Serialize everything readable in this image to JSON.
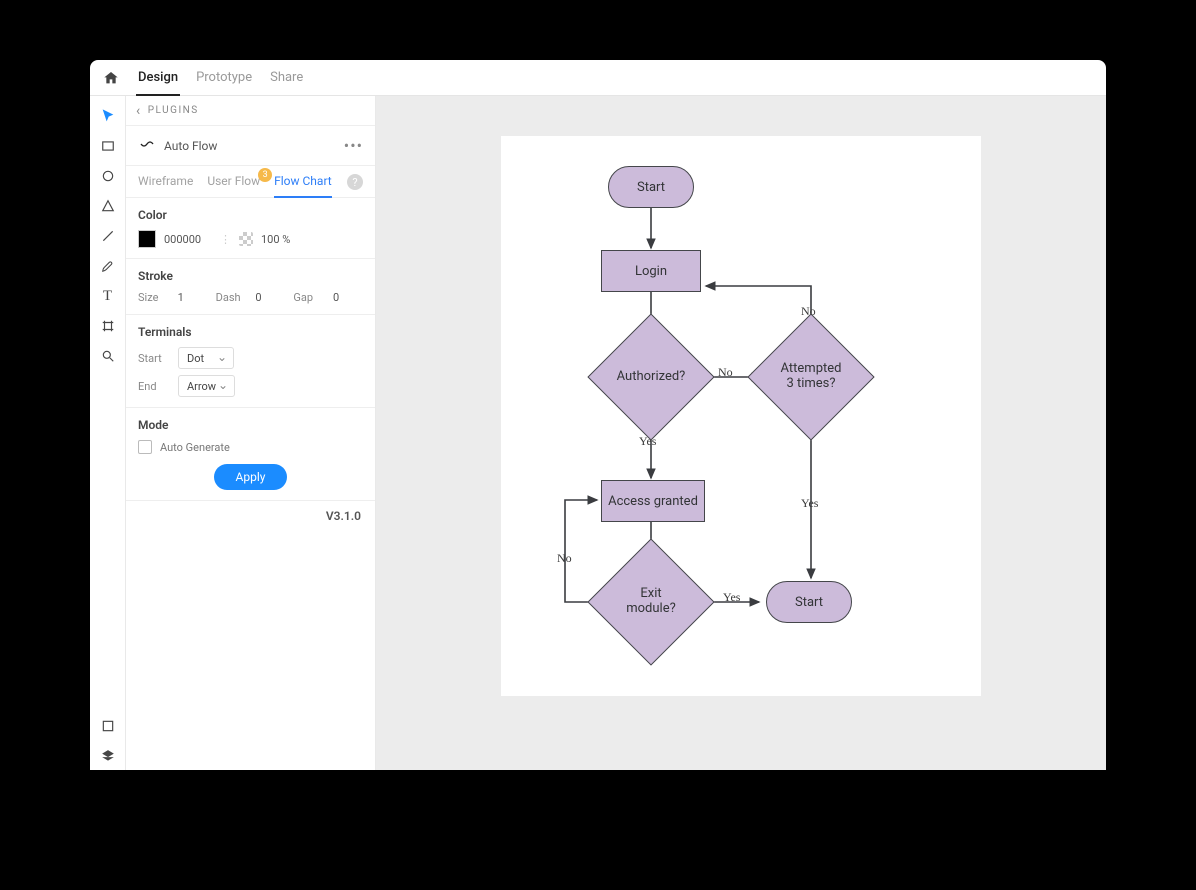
{
  "top": {
    "tabs": [
      "Design",
      "Prototype",
      "Share"
    ],
    "active": 0
  },
  "tools": [
    "select",
    "rect",
    "ellipse",
    "polygon",
    "line",
    "pen",
    "text",
    "artboard",
    "zoom"
  ],
  "panel": {
    "back_label": "PLUGINS",
    "plugin_name": "Auto Flow",
    "tabs": {
      "items": [
        "Wireframe",
        "User Flow",
        "Flow Chart"
      ],
      "active": 2,
      "badge": "3"
    },
    "color": {
      "title": "Color",
      "hex": "000000",
      "opacity": "100 %"
    },
    "stroke": {
      "title": "Stroke",
      "size_label": "Size",
      "size": "1",
      "dash_label": "Dash",
      "dash": "0",
      "gap_label": "Gap",
      "gap": "0"
    },
    "terminals": {
      "title": "Terminals",
      "start_label": "Start",
      "start": "Dot",
      "end_label": "End",
      "end": "Arrow"
    },
    "mode": {
      "title": "Mode",
      "auto_label": "Auto Generate"
    },
    "apply": "Apply",
    "version": "V3.1.0"
  },
  "flow": {
    "nodes": {
      "start": "Start",
      "login": "Login",
      "authorized": "Authorized?",
      "attempted": "Attempted\n3 times?",
      "access": "Access granted",
      "exit": "Exit\nmodule?",
      "end": "Start"
    },
    "labels": {
      "no": "No",
      "yes": "Yes"
    }
  }
}
